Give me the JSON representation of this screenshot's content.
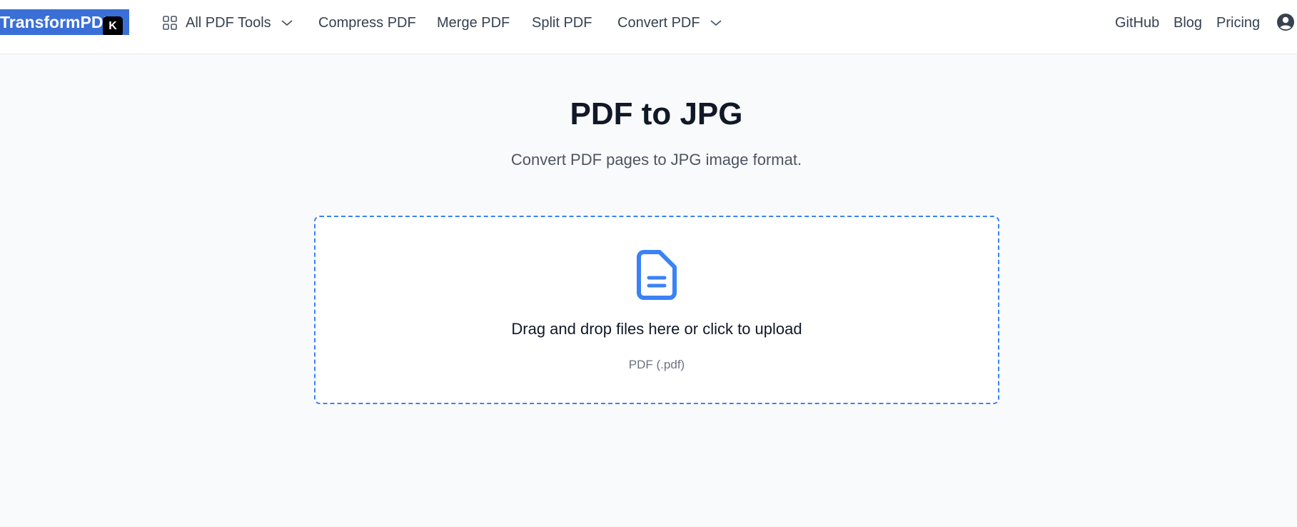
{
  "header": {
    "logo_text": "TransformPDFs",
    "logo_badge": "K",
    "nav": {
      "all_tools": "All PDF Tools",
      "compress": "Compress PDF",
      "merge": "Merge PDF",
      "split": "Split PDF",
      "convert": "Convert PDF"
    },
    "right_links": {
      "github": "GitHub",
      "blog": "Blog",
      "pricing": "Pricing"
    }
  },
  "main": {
    "title": "PDF to JPG",
    "subtitle": "Convert PDF pages to JPG image format.",
    "dropzone": {
      "text": "Drag and drop files here or click to upload",
      "hint": "PDF (.pdf)"
    }
  },
  "colors": {
    "accent": "#3b82f6",
    "logo_bg": "#3b6fd8",
    "page_bg": "#f9fafb"
  },
  "icons": {
    "apps": "grid-icon",
    "dropdown": "chevron-down-icon",
    "account": "user-circle-icon",
    "file": "file-text-icon"
  }
}
